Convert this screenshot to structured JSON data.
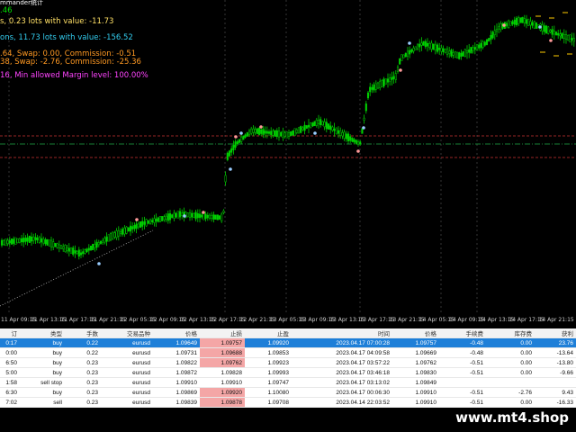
{
  "overlay": {
    "line0": "mmander统计",
    "line1": ".46",
    "line2": "s, 0.23 lots with value: -11.73",
    "line3": "ons, 11.73 lots with value: -156.52",
    "line4": ".64, Swap: 0.00, Commission: -0.51",
    "line5": "38, Swap: -2.76, Commission: -25.36",
    "line6": "16, Min allowed Margin level: 100.00%"
  },
  "time_axis": [
    "11 Apr 09:15",
    "11 Apr 13:15",
    "11 Apr 17:15",
    "11 Apr 21:15",
    "12 Apr 05:15",
    "12 Apr 09:15",
    "12 Apr 13:15",
    "12 Apr 17:15",
    "12 Apr 21:15",
    "13 Apr 05:15",
    "13 Apr 09:15",
    "13 Apr 13:15",
    "13 Apr 17:15",
    "13 Apr 21:15",
    "14 Apr 05:15",
    "14 Apr 09:15",
    "14 Apr 13:15",
    "14 Apr 17:15",
    "14 Apr 21:15"
  ],
  "table": {
    "headers": [
      "订",
      "类型",
      "手数",
      "交易品种",
      "价格",
      "止损",
      "止盈",
      "时间",
      "价格",
      "手续费",
      "库存费",
      "获利"
    ],
    "rows": [
      [
        "0:17",
        "buy",
        "0.22",
        "eurusd",
        "1.09649",
        "1.09757",
        "1.09920",
        "2023.04.17 07:00:28",
        "1.09757",
        "-0.48",
        "0.00",
        "23.76"
      ],
      [
        "0:00",
        "buy",
        "0.22",
        "eurusd",
        "1.09731",
        "1.09688",
        "1.09853",
        "2023.04.17 04:09:58",
        "1.09669",
        "-0.48",
        "0.00",
        "-13.64"
      ],
      [
        "6:50",
        "buy",
        "0.23",
        "eurusd",
        "1.09822",
        "1.09762",
        "1.09923",
        "2023.04.17 03:57:22",
        "1.09762",
        "-0.51",
        "0.00",
        "-13.80"
      ],
      [
        "5:00",
        "buy",
        "0.23",
        "eurusd",
        "1.09872",
        "1.09828",
        "1.09993",
        "2023.04.17 03:46:18",
        "1.09830",
        "-0.51",
        "0.00",
        "-9.66"
      ],
      [
        "1:58",
        "sell stop",
        "0.23",
        "eurusd",
        "1.09910",
        "1.09910",
        "1.09747",
        "2023.04.17 03:13:02",
        "1.09849",
        "",
        "",
        ""
      ],
      [
        "6:30",
        "buy",
        "0.23",
        "eurusd",
        "1.09869",
        "1.09920",
        "1.10080",
        "2023.04.17 00:06:30",
        "1.09910",
        "-0.51",
        "-2.76",
        "9.43"
      ],
      [
        "7:02",
        "sell",
        "0.23",
        "eurusd",
        "1.09839",
        "1.09878",
        "1.09708",
        "2023.04.14 22:03:52",
        "1.09910",
        "-0.51",
        "0.00",
        "-16.33"
      ]
    ],
    "selected_row": 0
  },
  "brand": "www.mt4.shop",
  "colors": {
    "bull": "#00d000",
    "bear": "#00d000",
    "selection": "#1e7fd8",
    "stoploss_cell": "#f4a6a6",
    "ask_line": "#cc3333",
    "grid": "#555555"
  }
}
